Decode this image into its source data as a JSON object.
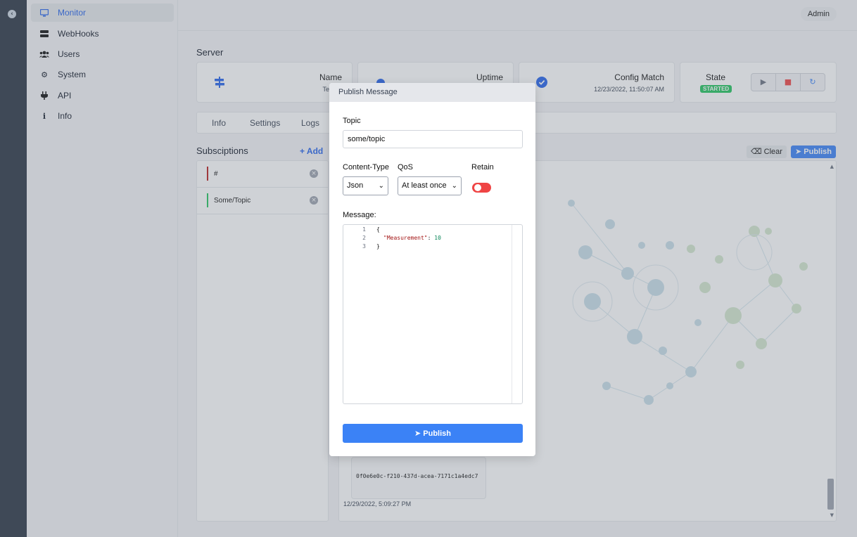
{
  "sidebar": {
    "items": [
      {
        "label": "Monitor",
        "icon": "monitor-icon",
        "active": true
      },
      {
        "label": "WebHooks",
        "icon": "webhooks-icon"
      },
      {
        "label": "Users",
        "icon": "users-icon"
      },
      {
        "label": "System",
        "icon": "gear-icon"
      },
      {
        "label": "API",
        "icon": "plug-icon"
      },
      {
        "label": "Info",
        "icon": "info-icon"
      }
    ]
  },
  "header": {
    "user": "Admin"
  },
  "server": {
    "title": "Server",
    "name_label": "Name",
    "name_value": "TestSe",
    "uptime_label": "Uptime",
    "config_label": "Config Match",
    "config_value": "12/23/2022, 11:50:07 AM",
    "state_label": "State",
    "state_value": "STARTED"
  },
  "tabs": [
    "Info",
    "Settings",
    "Logs"
  ],
  "subscriptions": {
    "title": "Subsciptions",
    "add_label": "+ Add",
    "items": [
      {
        "topic": "#",
        "color": "#b91c1c"
      },
      {
        "topic": "Some/Topic",
        "color": "#22c55e"
      }
    ]
  },
  "messages": {
    "clear_label": "Clear",
    "publish_label": "Publish",
    "card_id": "0f0e6e0c-f210-437d-acea-7171c1a4edc7",
    "card_time": "12/29/2022, 5:09:27 PM"
  },
  "modal": {
    "title": "Publish Message",
    "topic_label": "Topic",
    "topic_value": "some/topic",
    "content_type_label": "Content-Type",
    "content_type_value": "Json",
    "qos_label": "QoS",
    "qos_value": "At least once",
    "retain_label": "Retain",
    "retain_on": false,
    "message_label": "Message:",
    "code_lines": [
      {
        "n": "1",
        "text": "{"
      },
      {
        "n": "2",
        "key": "\"Measurement\"",
        "sep": ": ",
        "num": "10"
      },
      {
        "n": "3",
        "text": "}"
      }
    ],
    "publish_label": "Publish"
  },
  "colors": {
    "accent": "#3b82f6",
    "started": "#22c55e",
    "stop": "#ef4444"
  }
}
